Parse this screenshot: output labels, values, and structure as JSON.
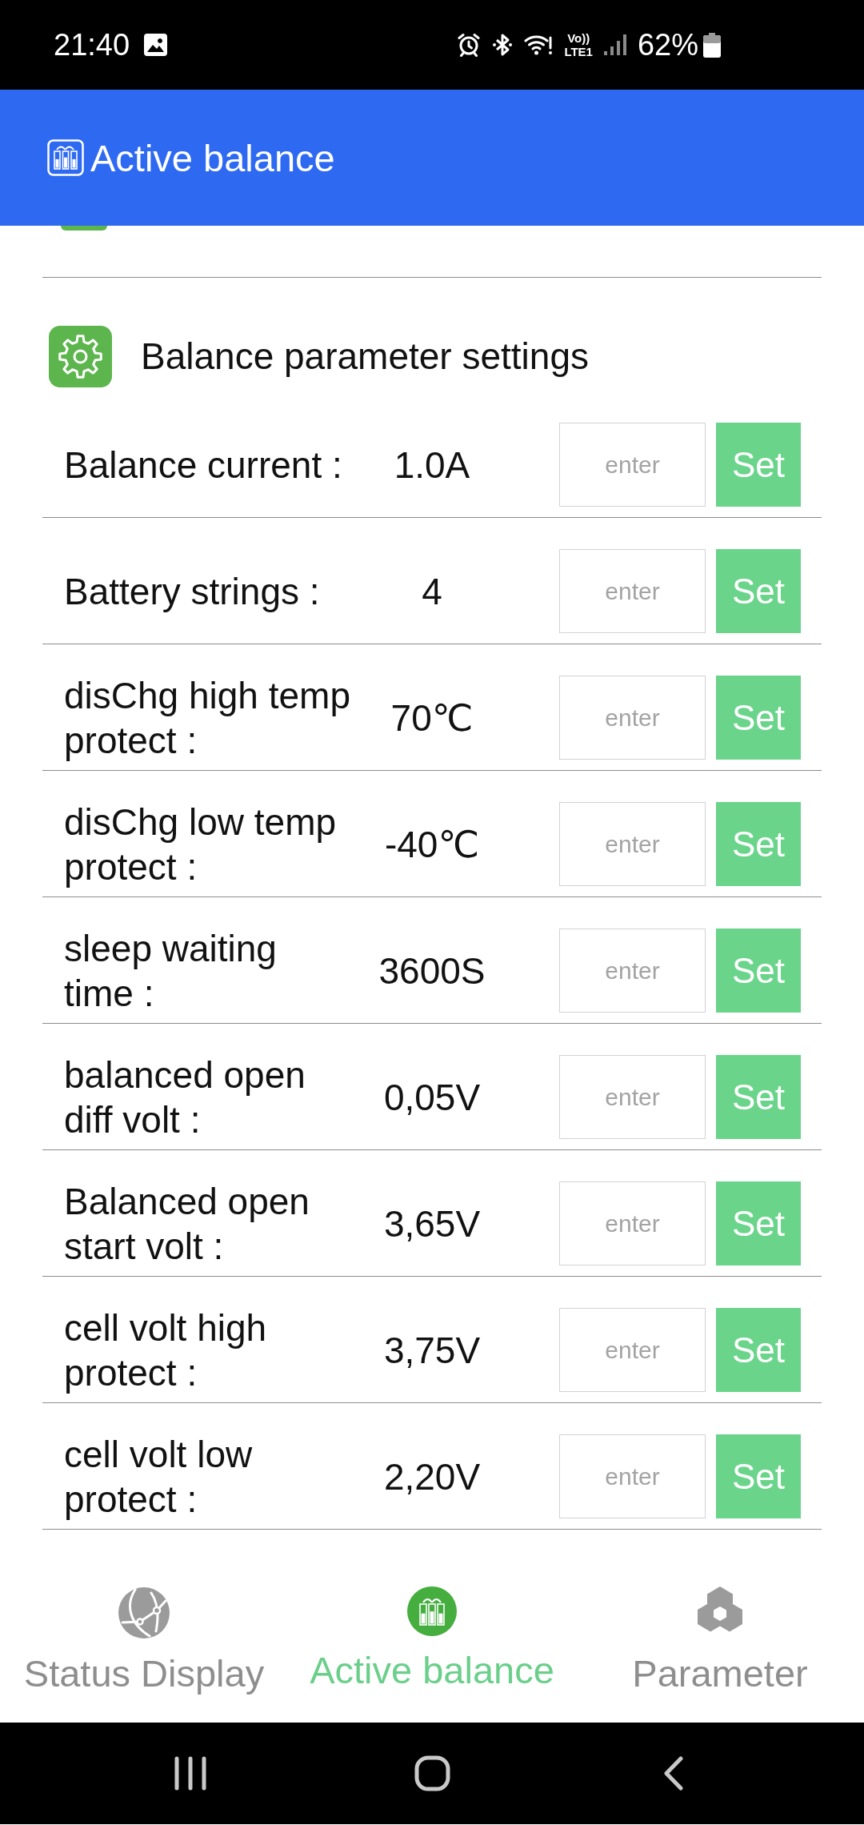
{
  "status_bar": {
    "time": "21:40",
    "volte": [
      "Vo))",
      "LTE1"
    ],
    "battery": "62%"
  },
  "app_bar": {
    "title": "Active balance"
  },
  "section": {
    "title": "Balance parameter settings"
  },
  "settings": [
    {
      "label": "Balance current :",
      "value": "1.0A",
      "placeholder": "enter",
      "button": "Set"
    },
    {
      "label": "Battery strings :",
      "value": "4",
      "placeholder": "enter",
      "button": "Set"
    },
    {
      "label": "disChg high temp\nprotect :",
      "value": "70℃",
      "placeholder": "enter",
      "button": "Set"
    },
    {
      "label": "disChg low temp\nprotect :",
      "value": "-40℃",
      "placeholder": "enter",
      "button": "Set"
    },
    {
      "label": "sleep waiting\ntime :",
      "value": "3600S",
      "placeholder": "enter",
      "button": "Set"
    },
    {
      "label": "balanced open\ndiff volt :",
      "value": "0,05V",
      "placeholder": "enter",
      "button": "Set"
    },
    {
      "label": "Balanced open\nstart volt :",
      "value": "3,65V",
      "placeholder": "enter",
      "button": "Set"
    },
    {
      "label": "cell volt high\nprotect :",
      "value": "3,75V",
      "placeholder": "enter",
      "button": "Set"
    },
    {
      "label": "cell volt low\nprotect :",
      "value": "2,20V",
      "placeholder": "enter",
      "button": "Set"
    }
  ],
  "bottom_nav": [
    {
      "label": "Status Display",
      "selected": false
    },
    {
      "label": "Active balance",
      "selected": true
    },
    {
      "label": "Parameter",
      "selected": false
    }
  ]
}
